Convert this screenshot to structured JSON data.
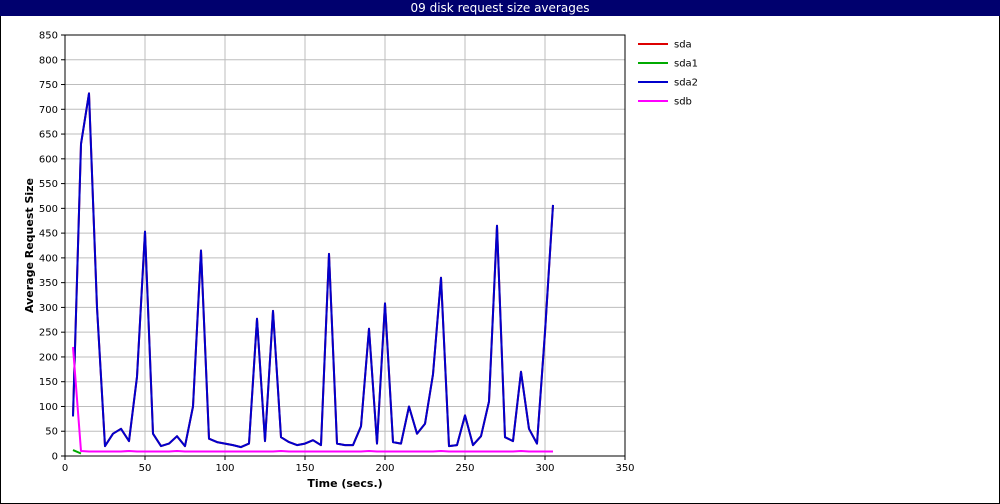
{
  "chart_data": {
    "type": "line",
    "title": "09 disk request size averages",
    "xlabel": "Time (secs.)",
    "ylabel": "Average Request Size",
    "xlim": [
      0,
      350
    ],
    "ylim": [
      0,
      850
    ],
    "xticks": [
      0,
      50,
      100,
      150,
      200,
      250,
      300,
      350
    ],
    "yticks": [
      0,
      50,
      100,
      150,
      200,
      250,
      300,
      350,
      400,
      450,
      500,
      550,
      600,
      650,
      700,
      750,
      800,
      850
    ],
    "grid": true,
    "legend_position": "right",
    "series": [
      {
        "name": "sda",
        "color": "#dd0000",
        "x": [
          5,
          10,
          15,
          20,
          25,
          30,
          35,
          40,
          45,
          50,
          55,
          60,
          65,
          70,
          75,
          80,
          85,
          90,
          95,
          100,
          105,
          110,
          115,
          120,
          125,
          130,
          135,
          140,
          145,
          150,
          155,
          160,
          165,
          170,
          175,
          180,
          185,
          190,
          195,
          200,
          205,
          210,
          215,
          220,
          225,
          230,
          235,
          240,
          245,
          250,
          255,
          260,
          265,
          270,
          275,
          280,
          285,
          290,
          295,
          300,
          305
        ],
        "y": [
          80,
          630,
          732,
          300,
          20,
          45,
          55,
          30,
          160,
          453,
          45,
          20,
          25,
          40,
          20,
          100,
          415,
          35,
          28,
          25,
          22,
          18,
          25,
          277,
          30,
          293,
          38,
          28,
          22,
          25,
          32,
          22,
          408,
          25,
          22,
          22,
          60,
          257,
          25,
          308,
          28,
          25,
          100,
          45,
          65,
          165,
          360,
          20,
          22,
          82,
          22,
          40,
          110,
          465,
          38,
          30,
          170,
          55,
          25,
          250,
          507
        ]
      },
      {
        "name": "sda1",
        "color": "#00aa00",
        "x": [
          5,
          10
        ],
        "y": [
          12,
          5
        ]
      },
      {
        "name": "sda2",
        "color": "#0000cc",
        "x": [
          5,
          10,
          15,
          20,
          25,
          30,
          35,
          40,
          45,
          50,
          55,
          60,
          65,
          70,
          75,
          80,
          85,
          90,
          95,
          100,
          105,
          110,
          115,
          120,
          125,
          130,
          135,
          140,
          145,
          150,
          155,
          160,
          165,
          170,
          175,
          180,
          185,
          190,
          195,
          200,
          205,
          210,
          215,
          220,
          225,
          230,
          235,
          240,
          245,
          250,
          255,
          260,
          265,
          270,
          275,
          280,
          285,
          290,
          295,
          300,
          305
        ],
        "y": [
          80,
          630,
          732,
          300,
          20,
          45,
          55,
          30,
          160,
          453,
          45,
          20,
          25,
          40,
          20,
          100,
          415,
          35,
          28,
          25,
          22,
          18,
          25,
          277,
          30,
          293,
          38,
          28,
          22,
          25,
          32,
          22,
          408,
          25,
          22,
          22,
          60,
          257,
          25,
          308,
          28,
          25,
          100,
          45,
          65,
          165,
          360,
          20,
          22,
          82,
          22,
          40,
          110,
          465,
          38,
          30,
          170,
          55,
          25,
          250,
          507
        ]
      },
      {
        "name": "sdb",
        "color": "#ff00ff",
        "x": [
          5,
          10,
          15,
          20,
          25,
          30,
          35,
          40,
          45,
          50,
          55,
          60,
          65,
          70,
          75,
          80,
          85,
          90,
          95,
          100,
          105,
          110,
          115,
          120,
          125,
          130,
          135,
          140,
          145,
          150,
          155,
          160,
          165,
          170,
          175,
          180,
          185,
          190,
          195,
          200,
          205,
          210,
          215,
          220,
          225,
          230,
          235,
          240,
          245,
          250,
          255,
          260,
          265,
          270,
          275,
          280,
          285,
          290,
          295,
          300,
          305
        ],
        "y": [
          220,
          10,
          9,
          9,
          9,
          9,
          9,
          10,
          9,
          9,
          9,
          9,
          9,
          10,
          9,
          9,
          9,
          9,
          9,
          9,
          9,
          9,
          9,
          9,
          9,
          9,
          10,
          9,
          9,
          9,
          9,
          9,
          9,
          9,
          9,
          9,
          9,
          10,
          9,
          9,
          9,
          9,
          9,
          9,
          9,
          9,
          10,
          9,
          9,
          9,
          9,
          9,
          9,
          9,
          9,
          9,
          10,
          9,
          9,
          9,
          9
        ]
      }
    ]
  }
}
